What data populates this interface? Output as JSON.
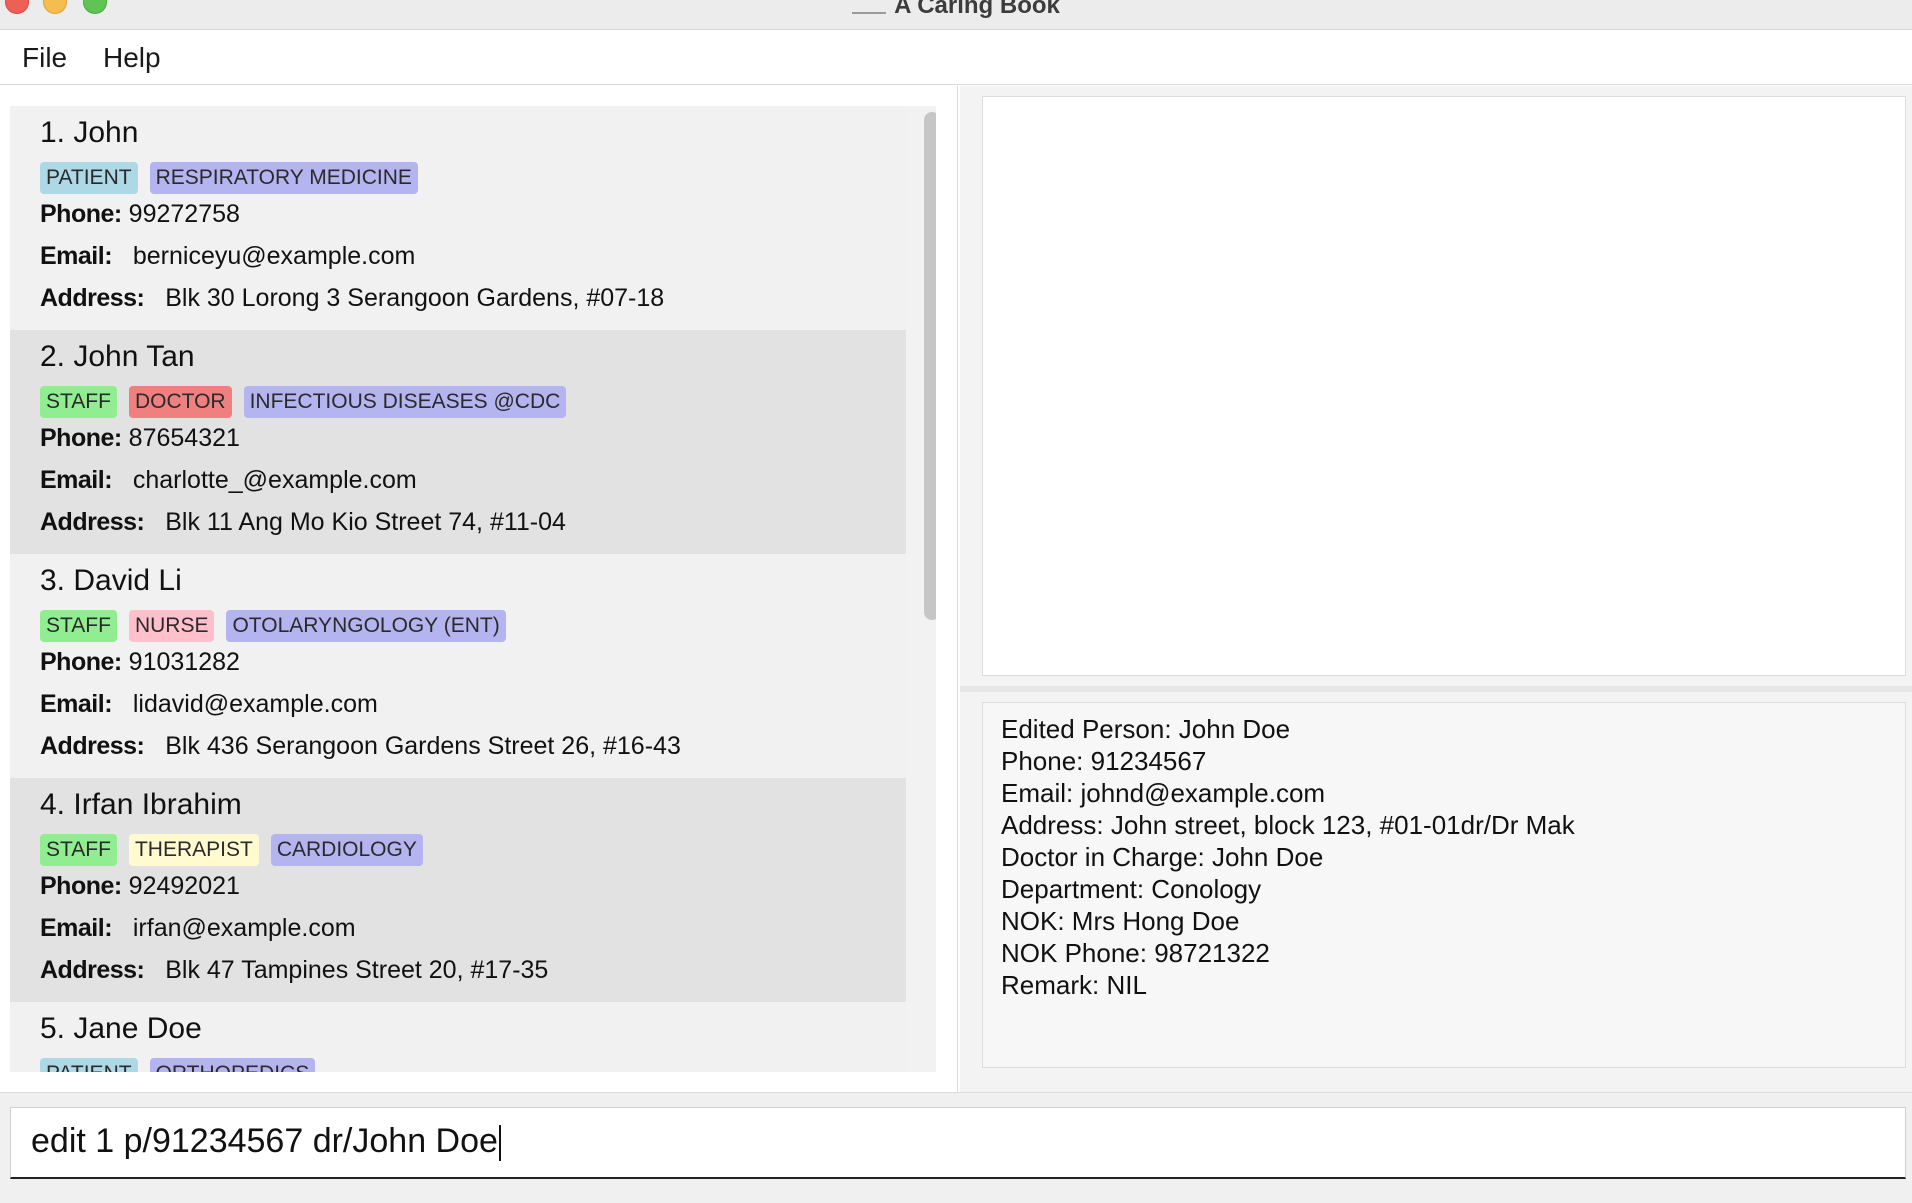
{
  "window": {
    "title": "A Caring Book"
  },
  "menu": {
    "file": "File",
    "help": "Help"
  },
  "persons": [
    {
      "index_name": "1. John",
      "tags": [
        {
          "label": "PATIENT",
          "color": "#add8e6"
        },
        {
          "label": "RESPIRATORY MEDICINE",
          "color": "#b4b4f0"
        }
      ],
      "phone_label": "Phone:",
      "phone": "99272758",
      "email_label": "Email:",
      "email": "berniceyu@example.com",
      "address_label": "Address:",
      "address": "Blk 30 Lorong 3 Serangoon Gardens, #07-18"
    },
    {
      "index_name": "2. John Tan",
      "tags": [
        {
          "label": "STAFF",
          "color": "#90ee90"
        },
        {
          "label": "DOCTOR",
          "color": "#f08080"
        },
        {
          "label": "INFECTIOUS DISEASES @CDC",
          "color": "#b4b4f0"
        }
      ],
      "phone_label": "Phone:",
      "phone": "87654321",
      "email_label": "Email:",
      "email": "charlotte_@example.com",
      "address_label": "Address:",
      "address": "Blk 11 Ang Mo Kio Street 74, #11-04"
    },
    {
      "index_name": "3. David Li",
      "tags": [
        {
          "label": "STAFF",
          "color": "#90ee90"
        },
        {
          "label": "NURSE",
          "color": "#ffc0cb"
        },
        {
          "label": "OTOLARYNGOLOGY (ENT)",
          "color": "#b4b4f0"
        }
      ],
      "phone_label": "Phone:",
      "phone": "91031282",
      "email_label": "Email:",
      "email": "lidavid@example.com",
      "address_label": "Address:",
      "address": "Blk 436 Serangoon Gardens Street 26, #16-43"
    },
    {
      "index_name": "4. Irfan Ibrahim",
      "tags": [
        {
          "label": "STAFF",
          "color": "#90ee90"
        },
        {
          "label": "THERAPIST",
          "color": "#fffad0"
        },
        {
          "label": "CARDIOLOGY",
          "color": "#b4b4f0"
        }
      ],
      "phone_label": "Phone:",
      "phone": "92492021",
      "email_label": "Email:",
      "email": "irfan@example.com",
      "address_label": "Address:",
      "address": "Blk 47 Tampines Street 20, #17-35"
    },
    {
      "index_name": "5. Jane Doe",
      "tags": [
        {
          "label": "PATIENT",
          "color": "#add8e6"
        },
        {
          "label": "ORTHOPEDICS",
          "color": "#b4b4f0"
        }
      ],
      "phone_label": "",
      "phone": "",
      "email_label": "",
      "email": "",
      "address_label": "",
      "address": ""
    }
  ],
  "result": {
    "lines": [
      "Edited Person: John Doe",
      "Phone: 91234567",
      "Email: johnd@example.com",
      "Address: John street, block 123, #01-01dr/Dr Mak",
      "Doctor in Charge: John Doe",
      "Department: Conology",
      "NOK: Mrs Hong Doe",
      "NOK Phone: 98721322",
      "Remark: NIL"
    ]
  },
  "command": {
    "value": "edit 1 p/91234567 dr/John Doe"
  }
}
